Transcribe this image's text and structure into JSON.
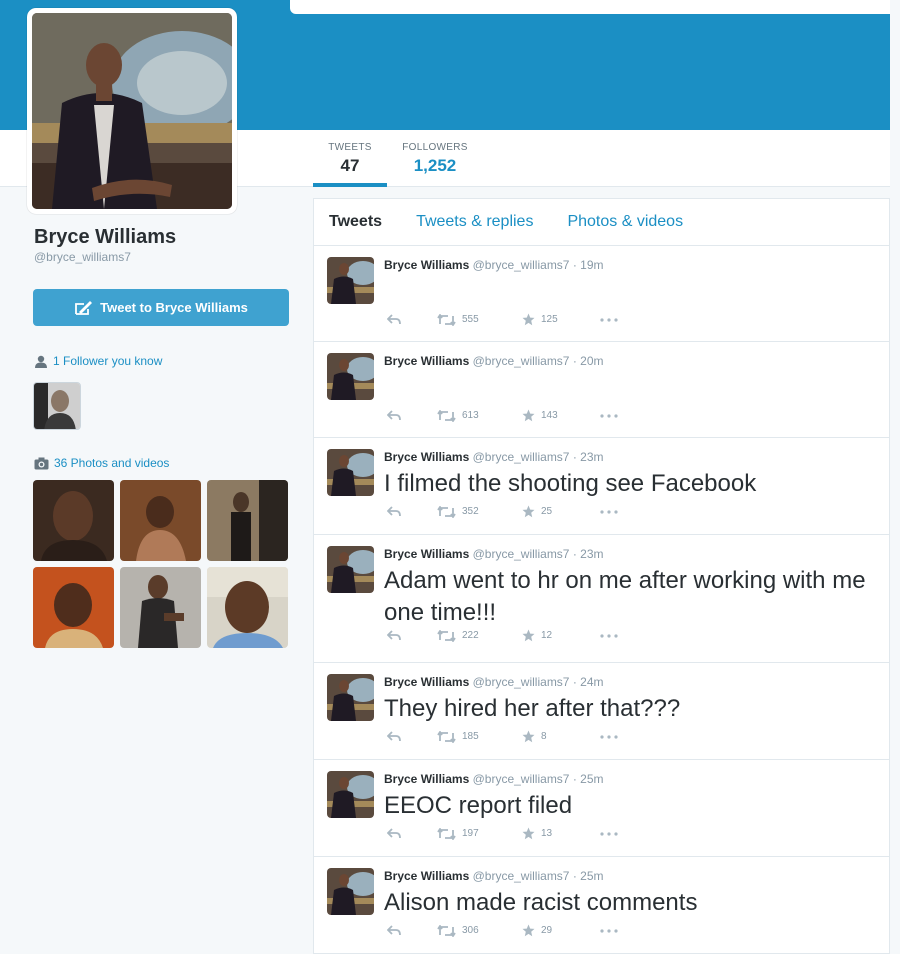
{
  "profile": {
    "name": "Bryce Williams",
    "handle": "@bryce_williams7",
    "tweet_to_label": "Tweet to Bryce Williams"
  },
  "stats": {
    "tweets_label": "TWEETS",
    "tweets_value": "47",
    "followers_label": "FOLLOWERS",
    "followers_value": "1,252"
  },
  "sidebar": {
    "followers_you_know": "1 Follower you know",
    "photos_videos": "36 Photos and videos"
  },
  "tabs": [
    "Tweets",
    "Tweets & replies",
    "Photos & videos"
  ],
  "tweets": [
    {
      "name": "Bryce Williams",
      "handle": "@bryce_williams7",
      "time": "19m",
      "text": "",
      "retweets": "555",
      "favorites": "125"
    },
    {
      "name": "Bryce Williams",
      "handle": "@bryce_williams7",
      "time": "20m",
      "text": "",
      "retweets": "613",
      "favorites": "143"
    },
    {
      "name": "Bryce Williams",
      "handle": "@bryce_williams7",
      "time": "23m",
      "text": "I filmed the shooting see Facebook",
      "retweets": "352",
      "favorites": "25"
    },
    {
      "name": "Bryce Williams",
      "handle": "@bryce_williams7",
      "time": "23m",
      "text": "Adam went to hr on me after working with me one time!!!",
      "retweets": "222",
      "favorites": "12"
    },
    {
      "name": "Bryce Williams",
      "handle": "@bryce_williams7",
      "time": "24m",
      "text": "They hired her after that???",
      "retweets": "185",
      "favorites": "8"
    },
    {
      "name": "Bryce Williams",
      "handle": "@bryce_williams7",
      "time": "25m",
      "text": "EEOC report filed",
      "retweets": "197",
      "favorites": "13"
    },
    {
      "name": "Bryce Williams",
      "handle": "@bryce_williams7",
      "time": "25m",
      "text": "Alison made racist comments",
      "retweets": "306",
      "favorites": "29"
    }
  ],
  "icons": {
    "reply": "reply-icon",
    "retweet": "retweet-icon",
    "favorite": "star-icon",
    "more": "more-icon",
    "person": "person-icon",
    "camera": "camera-icon",
    "compose": "compose-icon"
  },
  "colors": {
    "brand": "#1b8fc4",
    "button": "#3fa2d0",
    "text": "#292f33",
    "muted": "#8899a6"
  }
}
